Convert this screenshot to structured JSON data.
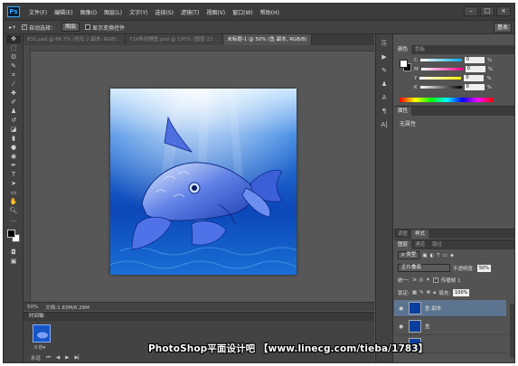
{
  "app": {
    "logo": "Ps",
    "menu": [
      "文件(F)",
      "编辑(E)",
      "图像(I)",
      "图层(L)",
      "文字(Y)",
      "选择(S)",
      "滤镜(T)",
      "视图(V)",
      "窗口(W)",
      "帮助(H)"
    ],
    "window_buttons": [
      "–",
      "□",
      "×"
    ]
  },
  "options_bar": {
    "tool_glyph": "▸+",
    "auto_select_label": "自动选择：",
    "auto_select_value": "图层",
    "show_transform_label": "显示变换控件",
    "workspace": "基本"
  },
  "tabs": [
    {
      "label": "831.psd @ 66.7% (矩形 2 副本, RGB/...",
      "active": false
    },
    {
      "label": "719条纹鲤鱼.psd @ 100% (图层 22 ...",
      "active": false
    },
    {
      "label": "未标题-1 @ 50% (鱼 副本, RGB/8)",
      "active": true
    }
  ],
  "status": {
    "zoom": "50%",
    "doc_info": "文档:1.83M/6.28M"
  },
  "timeline": {
    "title": "时间轴",
    "frame_time": "0 秒▾",
    "loop": "永远"
  },
  "panels": {
    "color_tabs": [
      "颜色",
      "色板"
    ],
    "cmyk": [
      {
        "label": "C",
        "value": "0",
        "unit": "%",
        "color": "#00aeef"
      },
      {
        "label": "M",
        "value": "0",
        "unit": "%",
        "color": "#ec008c"
      },
      {
        "label": "Y",
        "value": "0",
        "unit": "%",
        "color": "#fff200"
      },
      {
        "label": "K",
        "value": "0",
        "unit": "%",
        "color": "#000000"
      }
    ],
    "properties_tab": "属性",
    "properties_text": "无属性",
    "adjust_tabs": [
      "调整",
      "样式"
    ],
    "layers_tabs": [
      "图层",
      "通道",
      "路径"
    ],
    "layer_filter": "ρ 类型",
    "blend_mode": "正片叠底",
    "opacity_label": "不透明度:",
    "opacity_value": "50%",
    "unify_label": "统一:",
    "propagate_label": "传播帧 1",
    "lock_label": "锁定:",
    "fill_label": "填充:",
    "fill_value": "100%",
    "layers": [
      {
        "name": "鱼 副本",
        "active": true
      },
      {
        "name": "鱼",
        "active": false
      },
      {
        "name": "",
        "active": false
      }
    ]
  },
  "watermark": "PhotoShop平面设计吧 【www.linecg.com/tieba/1783】"
}
